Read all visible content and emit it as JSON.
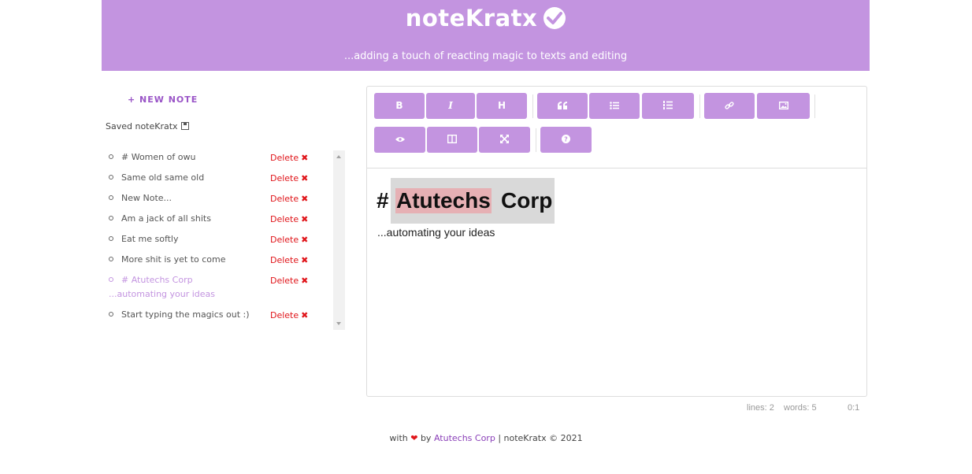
{
  "header": {
    "title": "noteKratx",
    "subtitle": "...adding a touch of reacting magic to texts and editing"
  },
  "sidebar": {
    "new_note_label": "+ NEW NOTE",
    "saved_label": "Saved noteKratx",
    "delete_label": "Delete",
    "delete_mark": "✖",
    "notes": [
      {
        "title": "# Women of owu"
      },
      {
        "title": "Same old same old"
      },
      {
        "title": "New Note..."
      },
      {
        "title": "Am a jack of all shits"
      },
      {
        "title": "Eat me softly"
      },
      {
        "title": "More shit is yet to come"
      },
      {
        "title": "# Atutechs Corp ...automating your ideas"
      },
      {
        "title": "Start typing the magics out :)"
      }
    ],
    "active_index": 6
  },
  "toolbar": {
    "bold": "B",
    "italic": "I",
    "heading": "H",
    "quote_icon": "quote-icon",
    "ul_icon": "unordered-list-icon",
    "ol_icon": "ordered-list-icon",
    "link_icon": "link-icon",
    "image_icon": "image-icon",
    "preview_icon": "eye-icon",
    "side_by_side_icon": "columns-icon",
    "fullscreen_icon": "fullscreen-icon",
    "guide_icon": "question-icon"
  },
  "editor": {
    "heading_hash": "#",
    "heading_word1": "Atutechs",
    "heading_word2": "Corp",
    "paragraph": "...automating your ideas"
  },
  "status": {
    "lines": "lines: 2",
    "words": "words: 5",
    "cursor": "0:1"
  },
  "footer": {
    "with": "with",
    "by": "by",
    "author": "Atutechs Corp",
    "rest": "| noteKratx © 2021"
  },
  "colors": {
    "accent": "#c394e0",
    "delete": "#e0151a",
    "highlight": "#e6b0b4"
  }
}
